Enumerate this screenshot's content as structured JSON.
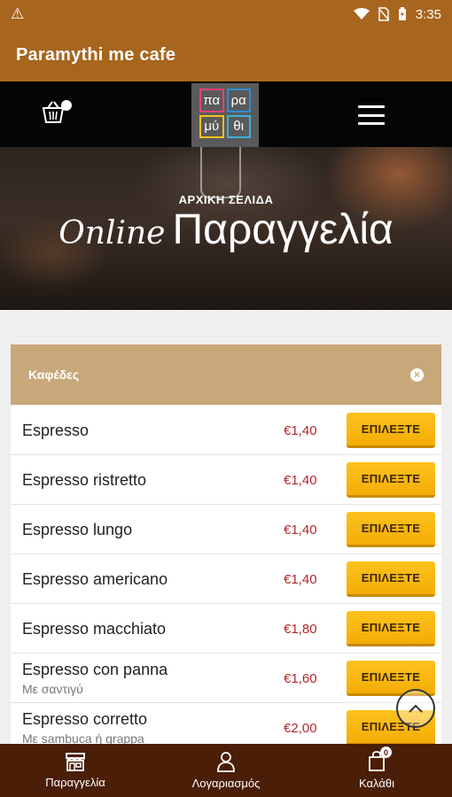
{
  "status_bar": {
    "time": "3:35"
  },
  "app_bar": {
    "title": "Paramythi me cafe"
  },
  "header": {
    "cart_count": "0",
    "logo_cells": [
      "πα",
      "ρα",
      "μύ",
      "θι"
    ]
  },
  "hero": {
    "subtitle": "ΑΡΧΙΚΗ ΣΕΛΙΔΑ",
    "headline_script": "Online",
    "headline_main": "Παραγγελία"
  },
  "category": {
    "title": "Καφέδες"
  },
  "products": [
    {
      "name": "Espresso",
      "desc": "",
      "price": "€1,40",
      "button": "ΕΠΙΛΕΞΤΕ"
    },
    {
      "name": "Espresso ristretto",
      "desc": "",
      "price": "€1,40",
      "button": "ΕΠΙΛΕΞΤΕ"
    },
    {
      "name": "Espresso lungo",
      "desc": "",
      "price": "€1,40",
      "button": "ΕΠΙΛΕΞΤΕ"
    },
    {
      "name": "Espresso americano",
      "desc": "",
      "price": "€1,40",
      "button": "ΕΠΙΛΕΞΤΕ"
    },
    {
      "name": "Espresso macchiato",
      "desc": "",
      "price": "€1,80",
      "button": "ΕΠΙΛΕΞΤΕ"
    },
    {
      "name": "Espresso con panna",
      "desc": "Με σαντιγύ",
      "price": "€1,60",
      "button": "ΕΠΙΛΕΞΤΕ"
    },
    {
      "name": "Espresso corretto",
      "desc": "Με sambuca ή grappa",
      "price": "€2,00",
      "button": "ΕΠΙΛΕΞΤΕ"
    }
  ],
  "bottom_nav": {
    "items": [
      {
        "label": "Παραγγελία",
        "icon": "store-icon"
      },
      {
        "label": "Λογαριασμός",
        "icon": "user-icon"
      },
      {
        "label": "Καλάθι",
        "icon": "bag-icon",
        "badge": "0"
      }
    ]
  },
  "colors": {
    "brand_brown": "#a8651e",
    "category_bar": "#c8a77a",
    "button_yellow": "#fdc21c",
    "price_red": "#b3272c",
    "nav_dark": "#4a1e07"
  }
}
